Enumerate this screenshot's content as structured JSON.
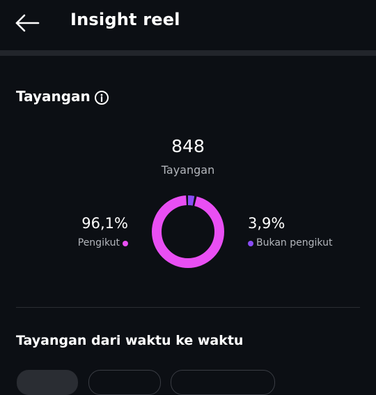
{
  "header": {
    "title": "Insight reel",
    "back_icon": "arrow-left-icon"
  },
  "views": {
    "title": "Tayangan",
    "info_icon": "info-icon",
    "total": "848",
    "total_label": "Tayangan",
    "followers": {
      "value": "96,1%",
      "label": "Pengikut",
      "fraction": 0.961,
      "color": "#e94ff3"
    },
    "non_followers": {
      "value": "3,9%",
      "label": "Bukan pengikut",
      "fraction": 0.039,
      "color": "#8a4cf5"
    }
  },
  "over_time": {
    "title": "Tayangan dari waktu ke waktu"
  },
  "colors": {
    "background": "#0c0f14",
    "divider": "#22252b",
    "muted_text": "#b3b6bc"
  }
}
